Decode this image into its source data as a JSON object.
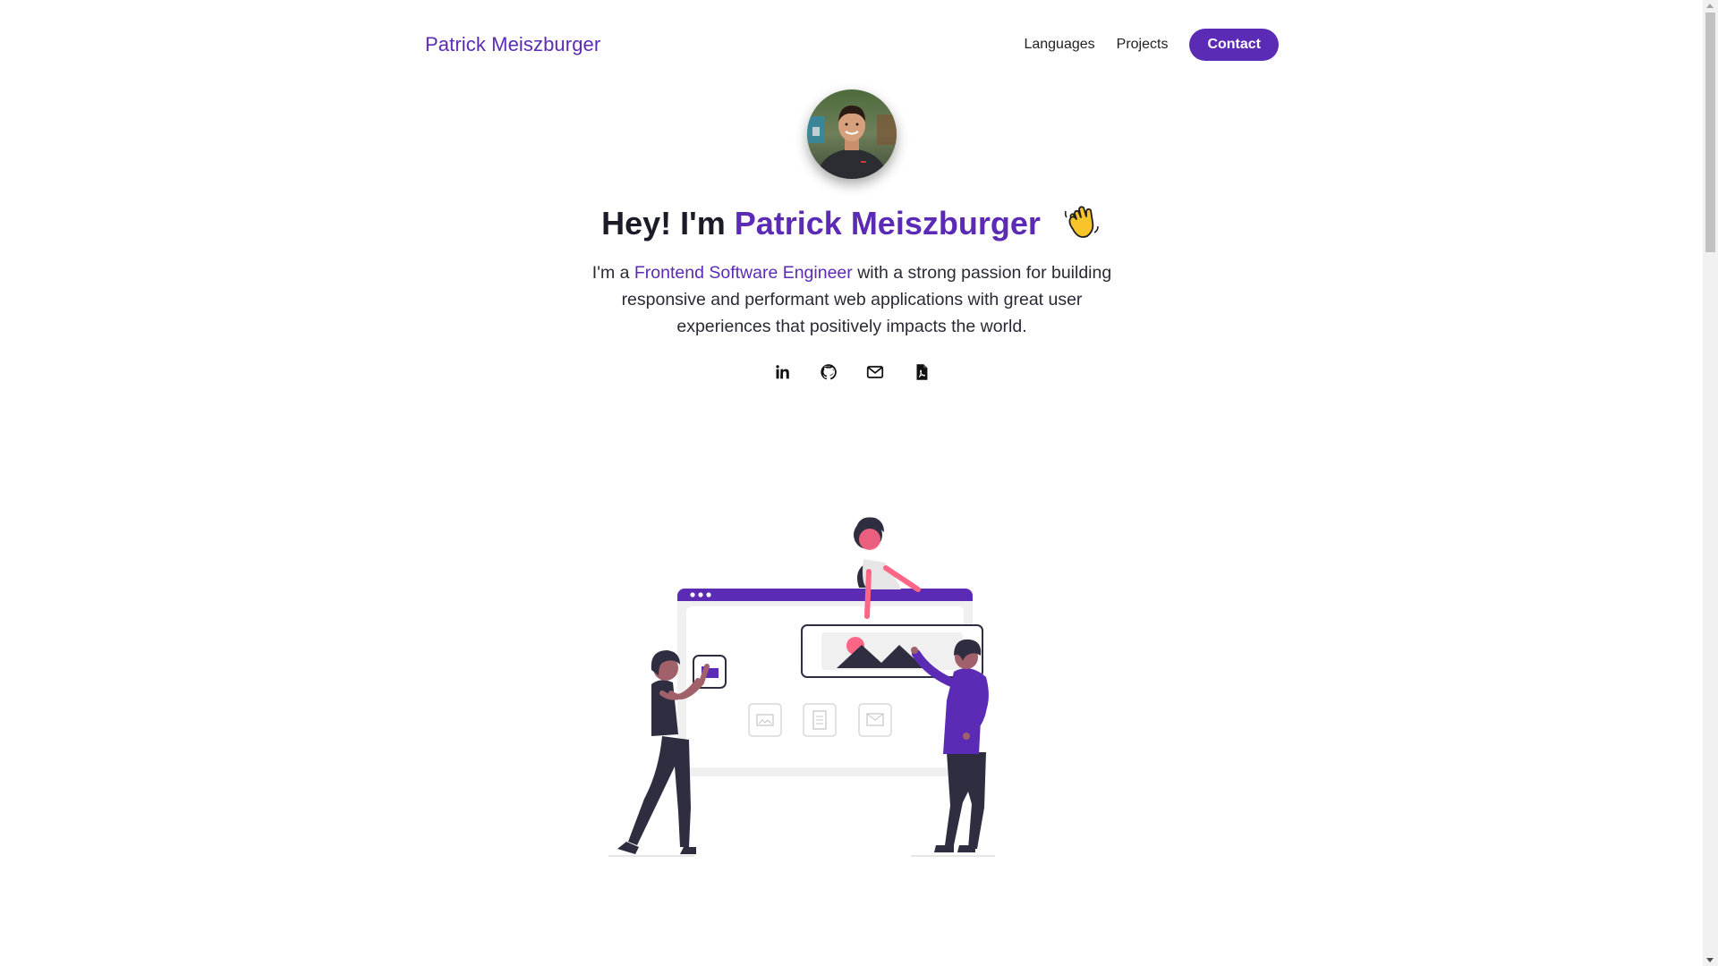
{
  "header": {
    "brand": "Patrick Meiszburger",
    "nav": [
      {
        "label": "Languages"
      },
      {
        "label": "Projects"
      }
    ],
    "contact_label": "Contact"
  },
  "hero": {
    "greeting": "Hey! I'm",
    "name": "Patrick Meiszburger",
    "wave_icon": "waving-hand-emoji",
    "desc_prefix": "I'm a",
    "role": "Frontend Software Engineer",
    "desc_suffix": "with a strong passion for building responsive and performant web applications with great user experiences that positively impacts the world."
  },
  "socials": [
    {
      "icon": "linkedin-icon"
    },
    {
      "icon": "github-icon"
    },
    {
      "icon": "mail-icon"
    },
    {
      "icon": "pdf-resume-icon"
    }
  ],
  "colors": {
    "accent": "#5b2bb5",
    "text": "#1c1c28",
    "illustration_dark": "#2f2e41",
    "illustration_pink": "#ff6584"
  }
}
